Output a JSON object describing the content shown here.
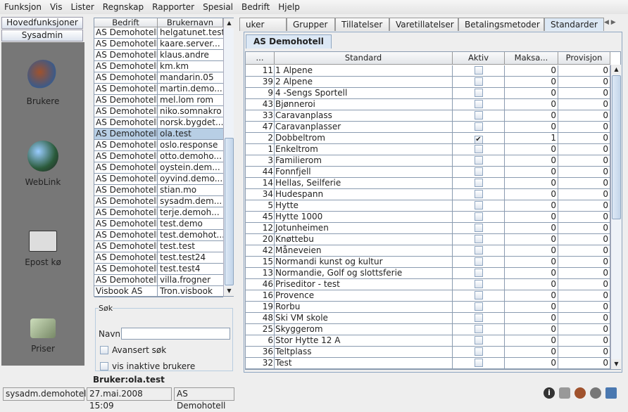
{
  "menu": [
    "Funksjon",
    "Vis",
    "Lister",
    "Regnskap",
    "Rapporter",
    "Spesial",
    "Bedrift",
    "Hjelp"
  ],
  "nav": {
    "main_button": "Hovedfunksjoner",
    "sysadmin_button": "Sysadmin",
    "items": [
      {
        "label": "Brukere",
        "icon": "users-icon"
      },
      {
        "label": "WebLink",
        "icon": "globe-icon"
      },
      {
        "label": "Epost kø",
        "icon": "mail-icon"
      },
      {
        "label": "Priser",
        "icon": "money-icon"
      }
    ]
  },
  "users": {
    "headers": [
      "Bedrift",
      "Brukernavn"
    ],
    "selected_index": 9,
    "rows": [
      [
        "AS Demohotell",
        "helgatunet.test"
      ],
      [
        "AS Demohotell",
        "kaare.server..."
      ],
      [
        "AS Demohotell",
        "klaus.andre"
      ],
      [
        "AS Demohotell",
        "km.km"
      ],
      [
        "AS Demohotell",
        "mandarin.05"
      ],
      [
        "AS Demohotell",
        "martin.demo..."
      ],
      [
        "AS Demohotell",
        "mel.lom rom"
      ],
      [
        "AS Demohotell",
        "niko.somnakro"
      ],
      [
        "AS Demohotell",
        "norsk.bygdet..."
      ],
      [
        "AS Demohotell",
        "ola.test"
      ],
      [
        "AS Demohotell",
        "oslo.response"
      ],
      [
        "AS Demohotell",
        "otto.demoho..."
      ],
      [
        "AS Demohotell",
        "oystein.dem..."
      ],
      [
        "AS Demohotell",
        "oyvind.demo..."
      ],
      [
        "AS Demohotell",
        "stian.mo"
      ],
      [
        "AS Demohotell",
        "sysadm.dem..."
      ],
      [
        "AS Demohotell",
        "terje.demoh..."
      ],
      [
        "AS Demohotell",
        "test.demo"
      ],
      [
        "AS Demohotell",
        "test.demohot..."
      ],
      [
        "AS Demohotell",
        "test.test"
      ],
      [
        "AS Demohotell",
        "test.test24"
      ],
      [
        "AS Demohotell",
        "test.test4"
      ],
      [
        "AS Demohotell",
        "villa.frogner"
      ],
      [
        "Visbook AS",
        "Tron.visbook"
      ]
    ]
  },
  "search": {
    "legend": "Søk",
    "name_label": "Navn:",
    "name_value": "",
    "advanced": "Avansert søk",
    "inactive": "vis inaktive brukere"
  },
  "current_user": "Bruker:ola.test",
  "tabs": [
    "uker info",
    "Grupper",
    "Tillatelser",
    "Varetillatelser",
    "Betalingsmetoder",
    "Standarder"
  ],
  "active_tab": "Standarder",
  "subtab": "AS Demohotell",
  "standards": {
    "headers": [
      "...",
      "Standard",
      "Aktiv",
      "Maksa...",
      "Provisjon"
    ],
    "rows": [
      [
        11,
        "1 Alpene",
        false,
        0,
        0
      ],
      [
        39,
        "2 Alpene",
        false,
        0,
        0
      ],
      [
        9,
        "4 -Sengs Sportell",
        false,
        0,
        0
      ],
      [
        43,
        "Bjønneroi",
        false,
        0,
        0
      ],
      [
        33,
        "Caravanplass",
        false,
        0,
        0
      ],
      [
        47,
        "Caravanplasser",
        false,
        0,
        0
      ],
      [
        2,
        "Dobbeltrom",
        true,
        1,
        0
      ],
      [
        1,
        "Enkeltrom",
        false,
        0,
        0
      ],
      [
        3,
        "Familierom",
        false,
        0,
        0
      ],
      [
        44,
        "Fonnfjell",
        false,
        0,
        0
      ],
      [
        14,
        "Hellas, Seilferie",
        false,
        0,
        0
      ],
      [
        34,
        "Hudespann",
        false,
        0,
        0
      ],
      [
        5,
        "Hytte",
        false,
        0,
        0
      ],
      [
        45,
        "Hytte 1000",
        false,
        0,
        0
      ],
      [
        12,
        "Jotunheimen",
        false,
        0,
        0
      ],
      [
        20,
        "Knøttebu",
        false,
        0,
        0
      ],
      [
        42,
        "Måneveien",
        false,
        0,
        0
      ],
      [
        15,
        "Normandi kunst og kultur",
        false,
        0,
        0
      ],
      [
        13,
        "Normandie, Golf og slottsferie",
        false,
        0,
        0
      ],
      [
        46,
        "Priseditor - test",
        false,
        0,
        0
      ],
      [
        16,
        "Provence",
        false,
        0,
        0
      ],
      [
        19,
        "Rorbu",
        false,
        0,
        0
      ],
      [
        48,
        "Ski VM skole",
        false,
        0,
        0
      ],
      [
        25,
        "Skyggerom",
        false,
        0,
        0
      ],
      [
        6,
        "Stor Hytte 12 A",
        false,
        0,
        0
      ],
      [
        36,
        "Teltplass",
        false,
        0,
        0
      ],
      [
        32,
        "Test",
        false,
        0,
        0
      ]
    ]
  },
  "statusbar": {
    "user": "sysadm.demohotell",
    "datetime": "27.mai.2008 15:09",
    "company": "AS Demohotell"
  }
}
